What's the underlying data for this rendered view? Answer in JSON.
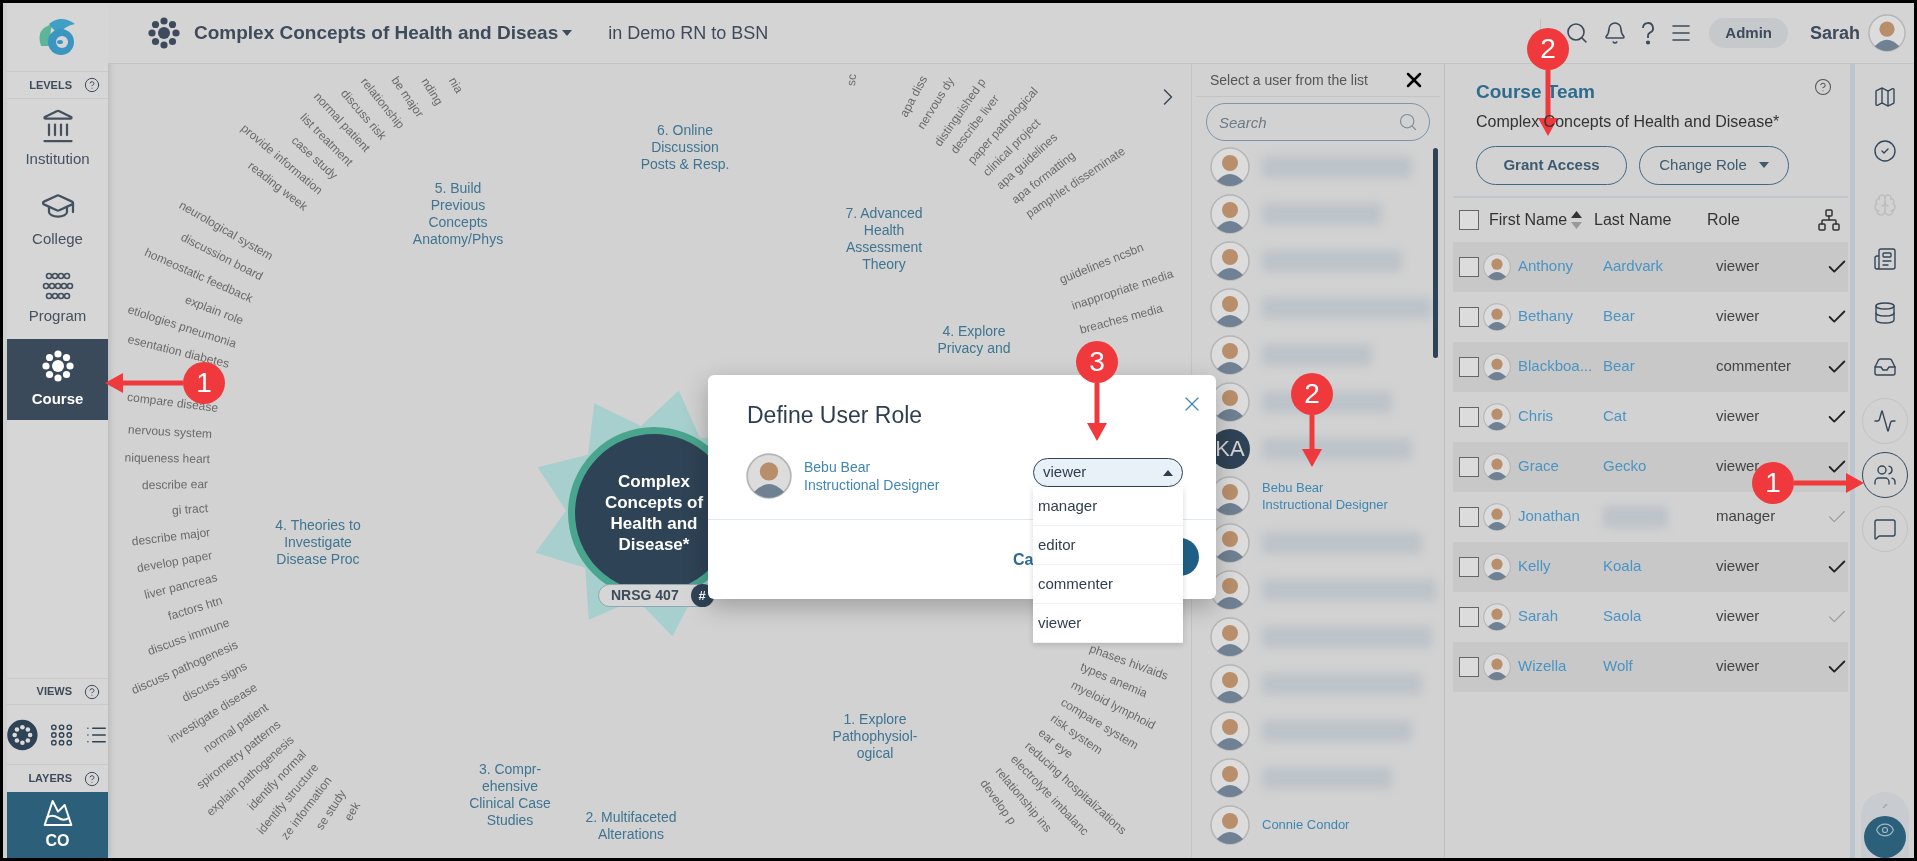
{
  "topbar": {
    "title": "Complex Concepts of Health and Diseas",
    "context": "in Demo RN to BSN",
    "admin": "Admin",
    "user": "Sarah"
  },
  "sidebar": {
    "levels_label": "LEVELS",
    "levels": [
      {
        "kind": "institution",
        "label": "Institution",
        "selected": false
      },
      {
        "kind": "college",
        "label": "College",
        "selected": false
      },
      {
        "kind": "program",
        "label": "Program",
        "selected": false
      },
      {
        "kind": "course",
        "label": "Course",
        "selected": true
      }
    ],
    "views_label": "VIEWS",
    "views": [
      {
        "kind": "wheel",
        "selected": true
      },
      {
        "kind": "grid",
        "selected": false
      },
      {
        "kind": "list",
        "selected": false
      }
    ],
    "layers_label": "LAYERS",
    "layer": "CO"
  },
  "map": {
    "center": "Complex Concepts of Health and Disease*",
    "code": "NRSG 407",
    "code_badge": "#",
    "topics": [
      {
        "lines": [
          "6. Online",
          "Discussion",
          "Posts & Resp."
        ]
      },
      {
        "lines": [
          "5. Build",
          "Previous",
          "Concepts",
          "Anatomy/Phys"
        ]
      },
      {
        "lines": [
          "7. Advanced",
          "Health",
          "Assessment",
          "Theory"
        ]
      },
      {
        "lines": [
          "4. Explore",
          "Privacy and"
        ]
      },
      {
        "lines": [
          "4. Theories to",
          "Investigate",
          "Disease Proc"
        ]
      },
      {
        "lines": [
          "3. Compr-",
          "ehensive",
          "Clinical Case",
          "Studies"
        ]
      },
      {
        "lines": [
          "2. Multifaceted",
          "Alterations"
        ]
      },
      {
        "lines": [
          "1. Explore",
          "Pathophysiol-",
          "ogical"
        ]
      }
    ],
    "terms": [
      "nia",
      "nding",
      "be major",
      "relationship",
      "discuss risk",
      "normal patient",
      "list treatment",
      "case study",
      "provide information",
      "reading week",
      "neurological system",
      "discussion board",
      "homeostatic feedback",
      "explain role",
      "etiologies pneumonia",
      "esentation diabetes",
      "compare disease",
      "nervous system",
      "niqueness heart",
      "describe ear",
      "gi tract",
      "describe major",
      "develop paper",
      "liver pancreas",
      "factors htn",
      "discuss immune",
      "discuss pathogenesis",
      "discuss signs",
      "investigate disease",
      "normal patient",
      "spirometry patterns",
      "explain pathogenesis",
      "identify normal",
      "identify structure",
      "ze information",
      "se study",
      "eek",
      "sc",
      "apa diss",
      "nervous dy",
      "distinguished p",
      "describe liver",
      "paper pathological",
      "clinical project",
      "apa guidelines",
      "apa formatting",
      "pamphlet disseminate",
      "guidelines ncsbn",
      "inappropriate media",
      "breaches media",
      "phases hiv/aids",
      "types anemia",
      "myeloid lymphoid",
      "compare system",
      "risk system",
      "ear eye",
      "reducing hospitalizations",
      "electrolyte imbalanc",
      "relationship ins",
      "develop p"
    ]
  },
  "modal": {
    "title": "Define User Role",
    "name": "Bebu Bear",
    "role": "Instructional Designer",
    "select_value": "viewer",
    "expanded": true,
    "options": [
      "manager",
      "editor",
      "commenter",
      "viewer"
    ],
    "cancel": "Ca"
  },
  "user_list": {
    "title": "Select a user from the list",
    "search_placeholder": "Search",
    "items": [
      {
        "kind": "blurred"
      },
      {
        "kind": "blurred"
      },
      {
        "kind": "blurred"
      },
      {
        "kind": "blurred"
      },
      {
        "kind": "blurred"
      },
      {
        "kind": "blurred"
      },
      {
        "kind": "initials",
        "initials": "KA"
      },
      {
        "kind": "named",
        "name": "Bebu Bear",
        "role": "Instructional Designer"
      },
      {
        "kind": "blurred"
      },
      {
        "kind": "blurred"
      },
      {
        "kind": "blurred"
      },
      {
        "kind": "blurred"
      },
      {
        "kind": "blurred"
      },
      {
        "kind": "blurred"
      },
      {
        "kind": "named",
        "name": "Connie Condor"
      }
    ]
  },
  "course_team": {
    "title": "Course Team",
    "subtitle": "Complex Concepts of Health and Disease*",
    "grant": "Grant Access",
    "change": "Change Role",
    "select_all_checked": false,
    "columns": [
      {
        "label": "First Name",
        "sort_ascending": true
      },
      {
        "label": "Last Name"
      },
      {
        "label": "Role"
      }
    ],
    "rows": [
      {
        "first": "Anthony",
        "last": "Aardvark",
        "role": "viewer",
        "checked": false,
        "faint": false
      },
      {
        "first": "Bethany",
        "last": "Bear",
        "role": "viewer",
        "checked": false,
        "faint": false
      },
      {
        "first": "Blackboa...",
        "last": "Bear",
        "role": "commenter",
        "checked": false,
        "faint": false
      },
      {
        "first": "Chris",
        "last": "Cat",
        "role": "viewer",
        "checked": false,
        "faint": false
      },
      {
        "first": "Grace",
        "last": "Gecko",
        "role": "viewer",
        "checked": false,
        "faint": false
      },
      {
        "first": "Jonathan",
        "role": "manager",
        "checked": false,
        "faint": true
      },
      {
        "first": "Kelly",
        "last": "Koala",
        "role": "viewer",
        "checked": false,
        "faint": false
      },
      {
        "first": "Sarah",
        "last": "Saola",
        "role": "viewer",
        "checked": false,
        "faint": true
      },
      {
        "first": "Wizella",
        "last": "Wolf",
        "role": "viewer",
        "checked": false,
        "faint": false
      }
    ]
  },
  "rail": [
    {
      "kind": "map",
      "selected": false,
      "disabled": false
    },
    {
      "kind": "check",
      "selected": false,
      "disabled": false
    },
    {
      "kind": "brain",
      "selected": false,
      "disabled": true
    },
    {
      "kind": "newspaper",
      "selected": false,
      "disabled": false
    },
    {
      "kind": "database",
      "selected": false,
      "disabled": false
    },
    {
      "kind": "inbox",
      "selected": false,
      "disabled": false
    },
    {
      "kind": "activity",
      "selected": false,
      "disabled": false
    },
    {
      "kind": "users",
      "selected": true,
      "disabled": false
    },
    {
      "kind": "message",
      "selected": false,
      "disabled": false
    }
  ],
  "annotations": [
    {
      "number": "1",
      "kind": "left"
    },
    {
      "number": "2",
      "kind": "down"
    },
    {
      "number": "3",
      "kind": "down"
    },
    {
      "number": "2",
      "kind": "down"
    },
    {
      "number": "1",
      "kind": "right"
    }
  ]
}
